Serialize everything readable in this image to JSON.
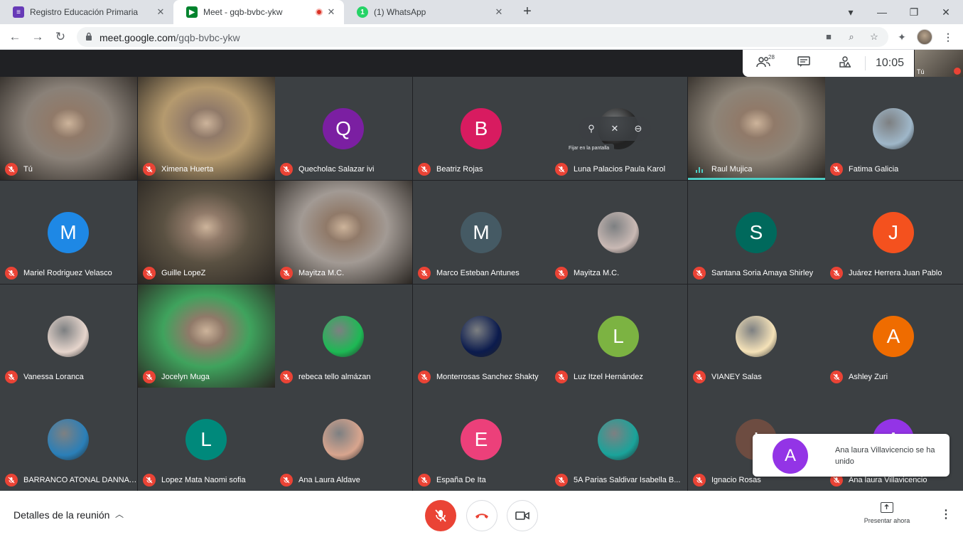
{
  "browser": {
    "tabs": [
      {
        "title": "Registro Educación Primaria",
        "icon": "forms-icon",
        "color": "#673ab7"
      },
      {
        "title": "Meet - gqb-bvbc-ykw",
        "icon": "meet-icon",
        "color": "#00832d"
      },
      {
        "title": "(1) WhatsApp",
        "icon": "whatsapp-icon",
        "color": "#25d366",
        "badge": "1"
      }
    ],
    "url_host": "meet.google.com",
    "url_path": "/gqb-bvbc-ykw"
  },
  "meet": {
    "participant_count": "28",
    "time": "10:05",
    "self_label": "Tú",
    "hover_tooltip": "Fijar en la pantalla",
    "participants": [
      {
        "name": "Tú",
        "kind": "video",
        "bg": "#8a8178"
      },
      {
        "name": "Ximena Huerta",
        "kind": "video",
        "bg": "#b59a6e"
      },
      {
        "name": "Quecholac Salazar ivi",
        "kind": "letter",
        "letter": "Q",
        "color": "#7b1fa2"
      },
      {
        "name": "Beatriz Rojas",
        "kind": "letter",
        "letter": "B",
        "color": "#d81b60"
      },
      {
        "name": "Luna Palacios Paula Karol",
        "kind": "photo",
        "color": "#222222"
      },
      {
        "name": "Raul Mujica",
        "kind": "video",
        "bg": "#8d8478",
        "speaking": true
      },
      {
        "name": "Fatima Galicia",
        "kind": "photo",
        "color": "#9fb7c9"
      },
      {
        "name": "Mariel Rodriguez Velasco",
        "kind": "letter",
        "letter": "M",
        "color": "#1e88e5"
      },
      {
        "name": "Guille LopeZ",
        "kind": "video",
        "bg": "#5a5142"
      },
      {
        "name": "Mayitza M.C.",
        "kind": "video",
        "bg": "#a29a94"
      },
      {
        "name": "Marco Esteban Antunes",
        "kind": "letter",
        "letter": "M",
        "color": "#455a64"
      },
      {
        "name": "Mayitza M.C.",
        "kind": "photo",
        "color": "#c9b9b4"
      },
      {
        "name": "Santana Soria Amaya Shirley",
        "kind": "letter",
        "letter": "S",
        "color": "#00695c"
      },
      {
        "name": "Juárez Herrera Juan Pablo",
        "kind": "letter",
        "letter": "J",
        "color": "#f4511e"
      },
      {
        "name": "Vanessa Loranca",
        "kind": "photo",
        "color": "#e6d5cc"
      },
      {
        "name": "Jocelyn Muga",
        "kind": "video",
        "bg": "#3fa35d"
      },
      {
        "name": "rebeca tello almázan",
        "kind": "photo",
        "color": "#1db954"
      },
      {
        "name": "Monterrosas Sanchez Shakty",
        "kind": "photo",
        "color": "#0b1b4d"
      },
      {
        "name": "Luz Itzel Hernández",
        "kind": "letter",
        "letter": "L",
        "color": "#7cb342"
      },
      {
        "name": "VIANEY Salas",
        "kind": "photo",
        "color": "#f5e2b8"
      },
      {
        "name": "Ashley Zuri",
        "kind": "letter",
        "letter": "A",
        "color": "#ef6c00"
      },
      {
        "name": "BARRANCO ATONAL DANNA ...",
        "kind": "photo",
        "color": "#2a7fb8"
      },
      {
        "name": "Lopez Mata Naomi sofia",
        "kind": "letter",
        "letter": "L",
        "color": "#00897b"
      },
      {
        "name": "Ana Laura Aldave",
        "kind": "photo",
        "color": "#d8a58e"
      },
      {
        "name": "España De Ita",
        "kind": "letter",
        "letter": "E",
        "color": "#ec407a"
      },
      {
        "name": "5A Parias Saldivar Isabella B...",
        "kind": "photo",
        "color": "#1aa39a"
      },
      {
        "name": "Ignacio Rosas",
        "kind": "letter",
        "letter": "I",
        "color": "#6d4c41"
      },
      {
        "name": "Ana laura Villavicencio",
        "kind": "letter",
        "letter": "A",
        "color": "#9334e6"
      }
    ],
    "toast": {
      "letter": "A",
      "message": "Ana laura Villavicencio se ha unido"
    }
  },
  "bottom": {
    "details_label": "Detalles de la reunión",
    "present_label": "Presentar ahora"
  },
  "colors": {
    "accent": "#ea4335",
    "speaking": "#4ecdc4",
    "tile_bg": "#3c4043"
  }
}
